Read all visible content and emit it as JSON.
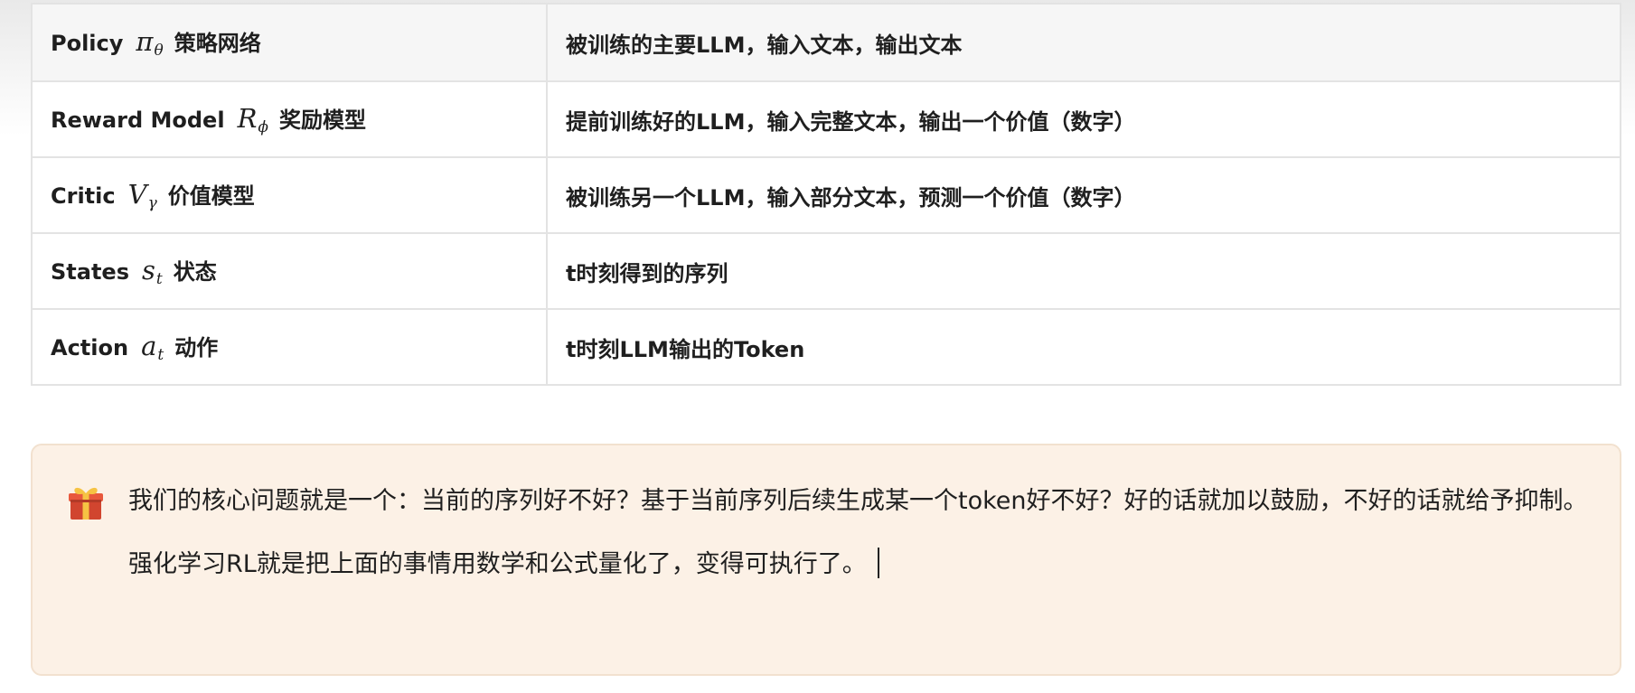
{
  "table": {
    "rows": [
      {
        "name": "Policy",
        "symbol": "π",
        "subscript": "θ",
        "zh": "策略网络",
        "description": "被训练的主要LLM，输入文本，输出文本"
      },
      {
        "name": "Reward Model",
        "symbol": "R",
        "subscript": "ϕ",
        "zh": "奖励模型",
        "description": "提前训练好的LLM，输入完整文本，输出一个价值（数字）"
      },
      {
        "name": "Critic",
        "symbol": "V",
        "subscript": "γ",
        "zh": "价值模型",
        "description": "被训练另一个LLM，输入部分文本，预测一个价值（数字）"
      },
      {
        "name": "States",
        "symbol": "s",
        "subscript": "t",
        "zh": "状态",
        "description": "t时刻得到的序列"
      },
      {
        "name": "Action",
        "symbol": "a",
        "subscript": "t",
        "zh": "动作",
        "description": "t时刻LLM输出的Token"
      }
    ]
  },
  "callout": {
    "icon": "gift-icon",
    "paragraph1": "我们的核心问题就是一个：当前的序列好不好？基于当前序列后续生成某一个token好不好？好的话就加以鼓励，不好的话就给予抑制。",
    "paragraph2": "强化学习RL就是把上面的事情用数学和公式量化了，变得可执行了。"
  },
  "colors": {
    "table_border": "#e3e3e3",
    "header_row_bg": "#f6f6f6",
    "callout_bg": "#fcf1e6",
    "callout_border": "#f2e1cf",
    "text": "#1f1f1f"
  }
}
